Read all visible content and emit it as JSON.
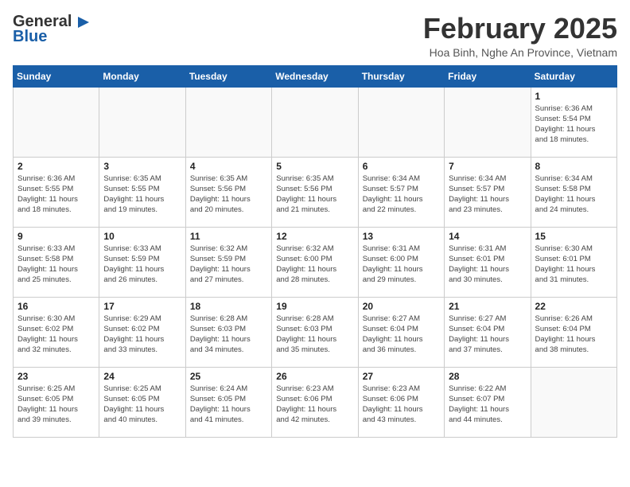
{
  "header": {
    "logo_general": "General",
    "logo_blue": "Blue",
    "title": "February 2025",
    "location": "Hoa Binh, Nghe An Province, Vietnam"
  },
  "weekdays": [
    "Sunday",
    "Monday",
    "Tuesday",
    "Wednesday",
    "Thursday",
    "Friday",
    "Saturday"
  ],
  "weeks": [
    [
      {
        "day": "",
        "info": ""
      },
      {
        "day": "",
        "info": ""
      },
      {
        "day": "",
        "info": ""
      },
      {
        "day": "",
        "info": ""
      },
      {
        "day": "",
        "info": ""
      },
      {
        "day": "",
        "info": ""
      },
      {
        "day": "1",
        "info": "Sunrise: 6:36 AM\nSunset: 5:54 PM\nDaylight: 11 hours\nand 18 minutes."
      }
    ],
    [
      {
        "day": "2",
        "info": "Sunrise: 6:36 AM\nSunset: 5:55 PM\nDaylight: 11 hours\nand 18 minutes."
      },
      {
        "day": "3",
        "info": "Sunrise: 6:35 AM\nSunset: 5:55 PM\nDaylight: 11 hours\nand 19 minutes."
      },
      {
        "day": "4",
        "info": "Sunrise: 6:35 AM\nSunset: 5:56 PM\nDaylight: 11 hours\nand 20 minutes."
      },
      {
        "day": "5",
        "info": "Sunrise: 6:35 AM\nSunset: 5:56 PM\nDaylight: 11 hours\nand 21 minutes."
      },
      {
        "day": "6",
        "info": "Sunrise: 6:34 AM\nSunset: 5:57 PM\nDaylight: 11 hours\nand 22 minutes."
      },
      {
        "day": "7",
        "info": "Sunrise: 6:34 AM\nSunset: 5:57 PM\nDaylight: 11 hours\nand 23 minutes."
      },
      {
        "day": "8",
        "info": "Sunrise: 6:34 AM\nSunset: 5:58 PM\nDaylight: 11 hours\nand 24 minutes."
      }
    ],
    [
      {
        "day": "9",
        "info": "Sunrise: 6:33 AM\nSunset: 5:58 PM\nDaylight: 11 hours\nand 25 minutes."
      },
      {
        "day": "10",
        "info": "Sunrise: 6:33 AM\nSunset: 5:59 PM\nDaylight: 11 hours\nand 26 minutes."
      },
      {
        "day": "11",
        "info": "Sunrise: 6:32 AM\nSunset: 5:59 PM\nDaylight: 11 hours\nand 27 minutes."
      },
      {
        "day": "12",
        "info": "Sunrise: 6:32 AM\nSunset: 6:00 PM\nDaylight: 11 hours\nand 28 minutes."
      },
      {
        "day": "13",
        "info": "Sunrise: 6:31 AM\nSunset: 6:00 PM\nDaylight: 11 hours\nand 29 minutes."
      },
      {
        "day": "14",
        "info": "Sunrise: 6:31 AM\nSunset: 6:01 PM\nDaylight: 11 hours\nand 30 minutes."
      },
      {
        "day": "15",
        "info": "Sunrise: 6:30 AM\nSunset: 6:01 PM\nDaylight: 11 hours\nand 31 minutes."
      }
    ],
    [
      {
        "day": "16",
        "info": "Sunrise: 6:30 AM\nSunset: 6:02 PM\nDaylight: 11 hours\nand 32 minutes."
      },
      {
        "day": "17",
        "info": "Sunrise: 6:29 AM\nSunset: 6:02 PM\nDaylight: 11 hours\nand 33 minutes."
      },
      {
        "day": "18",
        "info": "Sunrise: 6:28 AM\nSunset: 6:03 PM\nDaylight: 11 hours\nand 34 minutes."
      },
      {
        "day": "19",
        "info": "Sunrise: 6:28 AM\nSunset: 6:03 PM\nDaylight: 11 hours\nand 35 minutes."
      },
      {
        "day": "20",
        "info": "Sunrise: 6:27 AM\nSunset: 6:04 PM\nDaylight: 11 hours\nand 36 minutes."
      },
      {
        "day": "21",
        "info": "Sunrise: 6:27 AM\nSunset: 6:04 PM\nDaylight: 11 hours\nand 37 minutes."
      },
      {
        "day": "22",
        "info": "Sunrise: 6:26 AM\nSunset: 6:04 PM\nDaylight: 11 hours\nand 38 minutes."
      }
    ],
    [
      {
        "day": "23",
        "info": "Sunrise: 6:25 AM\nSunset: 6:05 PM\nDaylight: 11 hours\nand 39 minutes."
      },
      {
        "day": "24",
        "info": "Sunrise: 6:25 AM\nSunset: 6:05 PM\nDaylight: 11 hours\nand 40 minutes."
      },
      {
        "day": "25",
        "info": "Sunrise: 6:24 AM\nSunset: 6:05 PM\nDaylight: 11 hours\nand 41 minutes."
      },
      {
        "day": "26",
        "info": "Sunrise: 6:23 AM\nSunset: 6:06 PM\nDaylight: 11 hours\nand 42 minutes."
      },
      {
        "day": "27",
        "info": "Sunrise: 6:23 AM\nSunset: 6:06 PM\nDaylight: 11 hours\nand 43 minutes."
      },
      {
        "day": "28",
        "info": "Sunrise: 6:22 AM\nSunset: 6:07 PM\nDaylight: 11 hours\nand 44 minutes."
      },
      {
        "day": "",
        "info": ""
      }
    ]
  ]
}
